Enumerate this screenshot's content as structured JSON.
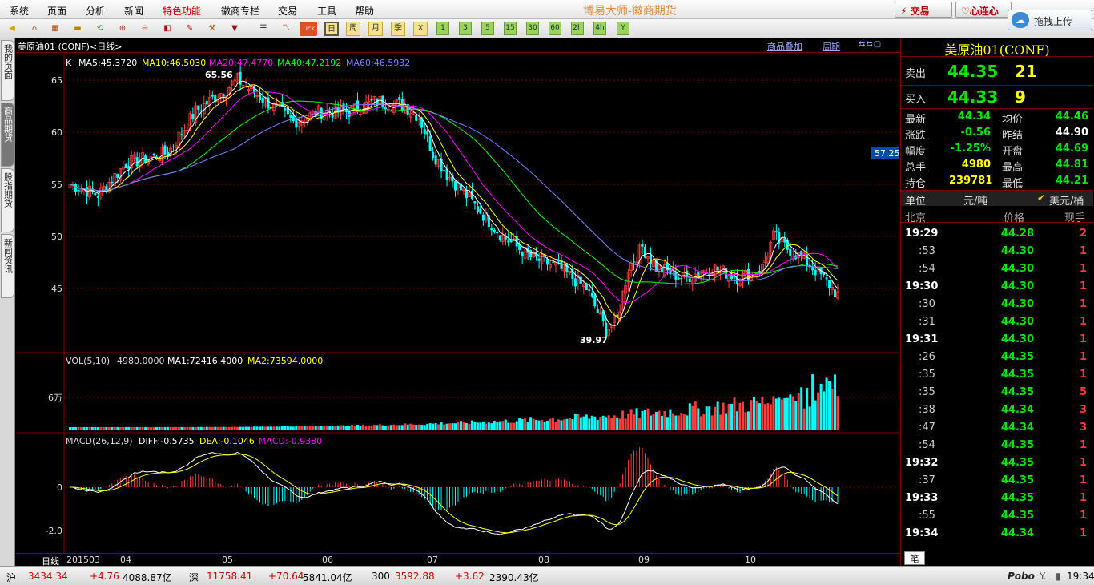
{
  "menu": [
    "系统",
    "页面",
    "分析",
    "新闻",
    "特色功能",
    "徽商专栏",
    "交易",
    "工具",
    "帮助"
  ],
  "app_title": "博易大师-徽商期货",
  "trade_btn": "交易",
  "xinlianxin_btn": "心连心",
  "upload_btn": "拖拽上传",
  "toolbar": {
    "tick": "Tick",
    "day": "日",
    "week": "周",
    "month": "月",
    "quarter": "季",
    "x": "X",
    "p1": "1",
    "p3": "3",
    "p5": "5",
    "p15": "15",
    "p30": "30",
    "p60": "60",
    "h2": "2h",
    "h4": "4h",
    "y": "Y"
  },
  "left_tabs": [
    "我的页面",
    "商品期货",
    "股指期货",
    "新闻资讯"
  ],
  "chart_header": {
    "title": "美原油01 (CONF)<日线>",
    "overlay": "商品叠加",
    "period": "周期"
  },
  "price_ma": {
    "k": "K",
    "ma5": "MA5:45.3720",
    "ma10": "MA10:46.5030",
    "ma20": "MA20:47.4770",
    "ma40": "MA40:47.2192",
    "ma60": "MA60:46.5932"
  },
  "vol_label": {
    "name": "VOL(5,10)",
    "val": "4980.0000",
    "ma1": "MA1:72416.4000",
    "ma2": "MA2:73594.0000"
  },
  "vol_tick": "6万",
  "macd_label": {
    "name": "MACD(26,12,9)",
    "diff": "DIFF:-0.5735",
    "dea": "DEA:-0.1046",
    "macd": "MACD:-0.9380"
  },
  "macd_ticks": [
    "0",
    "-2.0"
  ],
  "price_ticks": [
    "65",
    "60",
    "55",
    "50",
    "45"
  ],
  "price_label_box": "57.25",
  "annot_high": "65.56",
  "annot_low": "39.97",
  "x_labels": {
    "period": "日线",
    "start": "201503",
    "m04": "04",
    "m05": "05",
    "m06": "06",
    "m07": "07",
    "m08": "08",
    "m09": "09",
    "m10": "10"
  },
  "quote": {
    "title": "美原油01(CONF)",
    "sell_label": "卖出",
    "sell_price": "44.35",
    "sell_vol": "21",
    "buy_label": "买入",
    "buy_price": "44.33",
    "buy_vol": "9",
    "rows": [
      {
        "l1": "最新",
        "v1": "44.34",
        "l2": "均价",
        "v2": "44.46"
      },
      {
        "l1": "涨跌",
        "v1": "-0.56",
        "l2": "昨结",
        "v2": "44.90"
      },
      {
        "l1": "幅度",
        "v1": "-1.25%",
        "l2": "开盘",
        "v2": "44.69"
      },
      {
        "l1": "总手",
        "v1": "4980",
        "l2": "最高",
        "v2": "44.81"
      },
      {
        "l1": "持仓",
        "v1": "239781",
        "l2": "最低",
        "v2": "44.21"
      }
    ],
    "unit_label": "单位",
    "unit_val": "元/吨",
    "unit_opt": "美元/桶",
    "ticks_header": {
      "where": "北京",
      "price": "价格",
      "vol": "现手"
    },
    "ticks": [
      {
        "t": "19:29",
        "p": "44.28",
        "v": "2"
      },
      {
        "t": ":53",
        "p": "44.30",
        "v": "1"
      },
      {
        "t": ":54",
        "p": "44.30",
        "v": "1"
      },
      {
        "t": "19:30",
        "p": "44.30",
        "v": "1"
      },
      {
        "t": ":30",
        "p": "44.30",
        "v": "1"
      },
      {
        "t": ":31",
        "p": "44.30",
        "v": "1"
      },
      {
        "t": "19:31",
        "p": "44.30",
        "v": "1"
      },
      {
        "t": ":26",
        "p": "44.35",
        "v": "1"
      },
      {
        "t": ":35",
        "p": "44.35",
        "v": "1"
      },
      {
        "t": ":35",
        "p": "44.35",
        "v": "5"
      },
      {
        "t": ":38",
        "p": "44.34",
        "v": "3"
      },
      {
        "t": ":47",
        "p": "44.34",
        "v": "3"
      },
      {
        "t": ":54",
        "p": "44.35",
        "v": "1"
      },
      {
        "t": "19:32",
        "p": "44.35",
        "v": "1"
      },
      {
        "t": ":37",
        "p": "44.35",
        "v": "1"
      },
      {
        "t": "19:33",
        "p": "44.35",
        "v": "1"
      },
      {
        "t": ":55",
        "p": "44.35",
        "v": "1"
      },
      {
        "t": "19:34",
        "p": "44.34",
        "v": "1"
      }
    ],
    "bottom_tab": "笔"
  },
  "status": {
    "sh": "沪",
    "sh_idx": "3434.34",
    "sh_chg": "+4.76",
    "sh_amt": "4088.87亿",
    "sz": "深",
    "sz_idx": "11758.41",
    "sz_chg": "+70.64",
    "sz_amt": "5841.04亿",
    "hs": "300",
    "hs_idx": "3592.88",
    "hs_chg": "+3.62",
    "hs_amt": "2390.43亿",
    "brand": "Pobo",
    "time": "19:34"
  },
  "colors": {
    "up": "#ff3b3b",
    "down": "#00ffff",
    "ma5": "#ffffff",
    "ma10": "#ffff00",
    "ma20": "#ff00ff",
    "ma40": "#00ff00",
    "ma60": "#7f7fff",
    "grid": "#7a0000"
  }
}
